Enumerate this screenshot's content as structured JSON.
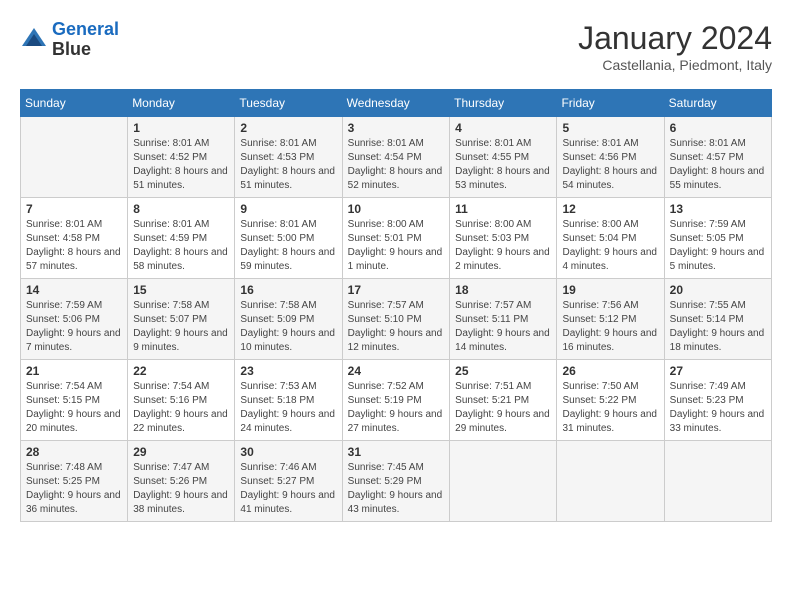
{
  "header": {
    "logo_line1": "General",
    "logo_line2": "Blue",
    "month": "January 2024",
    "location": "Castellania, Piedmont, Italy"
  },
  "weekdays": [
    "Sunday",
    "Monday",
    "Tuesday",
    "Wednesday",
    "Thursday",
    "Friday",
    "Saturday"
  ],
  "weeks": [
    [
      {
        "day": "",
        "sunrise": "",
        "sunset": "",
        "daylight": ""
      },
      {
        "day": "1",
        "sunrise": "Sunrise: 8:01 AM",
        "sunset": "Sunset: 4:52 PM",
        "daylight": "Daylight: 8 hours and 51 minutes."
      },
      {
        "day": "2",
        "sunrise": "Sunrise: 8:01 AM",
        "sunset": "Sunset: 4:53 PM",
        "daylight": "Daylight: 8 hours and 51 minutes."
      },
      {
        "day": "3",
        "sunrise": "Sunrise: 8:01 AM",
        "sunset": "Sunset: 4:54 PM",
        "daylight": "Daylight: 8 hours and 52 minutes."
      },
      {
        "day": "4",
        "sunrise": "Sunrise: 8:01 AM",
        "sunset": "Sunset: 4:55 PM",
        "daylight": "Daylight: 8 hours and 53 minutes."
      },
      {
        "day": "5",
        "sunrise": "Sunrise: 8:01 AM",
        "sunset": "Sunset: 4:56 PM",
        "daylight": "Daylight: 8 hours and 54 minutes."
      },
      {
        "day": "6",
        "sunrise": "Sunrise: 8:01 AM",
        "sunset": "Sunset: 4:57 PM",
        "daylight": "Daylight: 8 hours and 55 minutes."
      }
    ],
    [
      {
        "day": "7",
        "sunrise": "Sunrise: 8:01 AM",
        "sunset": "Sunset: 4:58 PM",
        "daylight": "Daylight: 8 hours and 57 minutes."
      },
      {
        "day": "8",
        "sunrise": "Sunrise: 8:01 AM",
        "sunset": "Sunset: 4:59 PM",
        "daylight": "Daylight: 8 hours and 58 minutes."
      },
      {
        "day": "9",
        "sunrise": "Sunrise: 8:01 AM",
        "sunset": "Sunset: 5:00 PM",
        "daylight": "Daylight: 8 hours and 59 minutes."
      },
      {
        "day": "10",
        "sunrise": "Sunrise: 8:00 AM",
        "sunset": "Sunset: 5:01 PM",
        "daylight": "Daylight: 9 hours and 1 minute."
      },
      {
        "day": "11",
        "sunrise": "Sunrise: 8:00 AM",
        "sunset": "Sunset: 5:03 PM",
        "daylight": "Daylight: 9 hours and 2 minutes."
      },
      {
        "day": "12",
        "sunrise": "Sunrise: 8:00 AM",
        "sunset": "Sunset: 5:04 PM",
        "daylight": "Daylight: 9 hours and 4 minutes."
      },
      {
        "day": "13",
        "sunrise": "Sunrise: 7:59 AM",
        "sunset": "Sunset: 5:05 PM",
        "daylight": "Daylight: 9 hours and 5 minutes."
      }
    ],
    [
      {
        "day": "14",
        "sunrise": "Sunrise: 7:59 AM",
        "sunset": "Sunset: 5:06 PM",
        "daylight": "Daylight: 9 hours and 7 minutes."
      },
      {
        "day": "15",
        "sunrise": "Sunrise: 7:58 AM",
        "sunset": "Sunset: 5:07 PM",
        "daylight": "Daylight: 9 hours and 9 minutes."
      },
      {
        "day": "16",
        "sunrise": "Sunrise: 7:58 AM",
        "sunset": "Sunset: 5:09 PM",
        "daylight": "Daylight: 9 hours and 10 minutes."
      },
      {
        "day": "17",
        "sunrise": "Sunrise: 7:57 AM",
        "sunset": "Sunset: 5:10 PM",
        "daylight": "Daylight: 9 hours and 12 minutes."
      },
      {
        "day": "18",
        "sunrise": "Sunrise: 7:57 AM",
        "sunset": "Sunset: 5:11 PM",
        "daylight": "Daylight: 9 hours and 14 minutes."
      },
      {
        "day": "19",
        "sunrise": "Sunrise: 7:56 AM",
        "sunset": "Sunset: 5:12 PM",
        "daylight": "Daylight: 9 hours and 16 minutes."
      },
      {
        "day": "20",
        "sunrise": "Sunrise: 7:55 AM",
        "sunset": "Sunset: 5:14 PM",
        "daylight": "Daylight: 9 hours and 18 minutes."
      }
    ],
    [
      {
        "day": "21",
        "sunrise": "Sunrise: 7:54 AM",
        "sunset": "Sunset: 5:15 PM",
        "daylight": "Daylight: 9 hours and 20 minutes."
      },
      {
        "day": "22",
        "sunrise": "Sunrise: 7:54 AM",
        "sunset": "Sunset: 5:16 PM",
        "daylight": "Daylight: 9 hours and 22 minutes."
      },
      {
        "day": "23",
        "sunrise": "Sunrise: 7:53 AM",
        "sunset": "Sunset: 5:18 PM",
        "daylight": "Daylight: 9 hours and 24 minutes."
      },
      {
        "day": "24",
        "sunrise": "Sunrise: 7:52 AM",
        "sunset": "Sunset: 5:19 PM",
        "daylight": "Daylight: 9 hours and 27 minutes."
      },
      {
        "day": "25",
        "sunrise": "Sunrise: 7:51 AM",
        "sunset": "Sunset: 5:21 PM",
        "daylight": "Daylight: 9 hours and 29 minutes."
      },
      {
        "day": "26",
        "sunrise": "Sunrise: 7:50 AM",
        "sunset": "Sunset: 5:22 PM",
        "daylight": "Daylight: 9 hours and 31 minutes."
      },
      {
        "day": "27",
        "sunrise": "Sunrise: 7:49 AM",
        "sunset": "Sunset: 5:23 PM",
        "daylight": "Daylight: 9 hours and 33 minutes."
      }
    ],
    [
      {
        "day": "28",
        "sunrise": "Sunrise: 7:48 AM",
        "sunset": "Sunset: 5:25 PM",
        "daylight": "Daylight: 9 hours and 36 minutes."
      },
      {
        "day": "29",
        "sunrise": "Sunrise: 7:47 AM",
        "sunset": "Sunset: 5:26 PM",
        "daylight": "Daylight: 9 hours and 38 minutes."
      },
      {
        "day": "30",
        "sunrise": "Sunrise: 7:46 AM",
        "sunset": "Sunset: 5:27 PM",
        "daylight": "Daylight: 9 hours and 41 minutes."
      },
      {
        "day": "31",
        "sunrise": "Sunrise: 7:45 AM",
        "sunset": "Sunset: 5:29 PM",
        "daylight": "Daylight: 9 hours and 43 minutes."
      },
      {
        "day": "",
        "sunrise": "",
        "sunset": "",
        "daylight": ""
      },
      {
        "day": "",
        "sunrise": "",
        "sunset": "",
        "daylight": ""
      },
      {
        "day": "",
        "sunrise": "",
        "sunset": "",
        "daylight": ""
      }
    ]
  ]
}
